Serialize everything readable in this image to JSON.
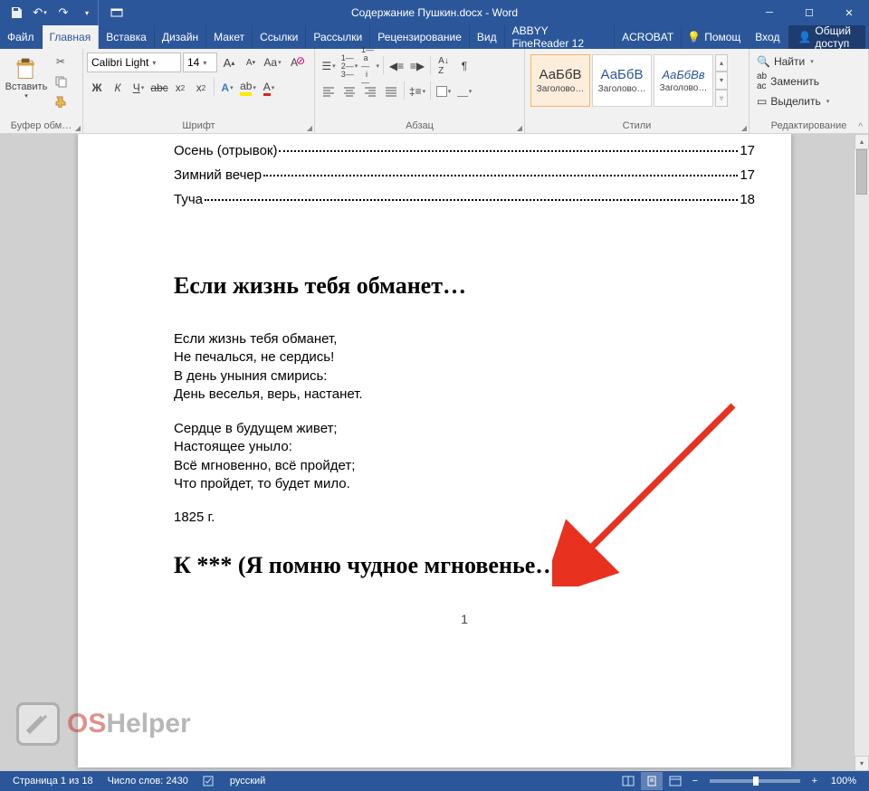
{
  "titlebar": {
    "title": "Содержание Пушкин.docx - Word"
  },
  "tabs": {
    "file": "Файл",
    "home": "Главная",
    "insert": "Вставка",
    "design": "Дизайн",
    "layout": "Макет",
    "references": "Ссылки",
    "mailings": "Рассылки",
    "review": "Рецензирование",
    "view": "Вид",
    "finereader": "ABBYY FineReader 12",
    "acrobat": "ACROBAT",
    "help": "Помощ",
    "signin": "Вход",
    "share": "Общий доступ"
  },
  "ribbon": {
    "clipboard": {
      "label": "Буфер обм…",
      "paste": "Вставить"
    },
    "font": {
      "label": "Шрифт",
      "name": "Calibri Light",
      "size": "14"
    },
    "paragraph": {
      "label": "Абзац"
    },
    "styles": {
      "label": "Стили",
      "items": [
        {
          "sample": "АаБбВ",
          "name": "Заголово…"
        },
        {
          "sample": "АаБбВ",
          "name": "Заголово…"
        },
        {
          "sample": "АаБбВв",
          "name": "Заголово…"
        }
      ]
    },
    "editing": {
      "label": "Редактирование",
      "find": "Найти",
      "replace": "Заменить",
      "select": "Выделить"
    }
  },
  "document": {
    "toc": [
      {
        "title": "Осень (отрывок)",
        "page": "17"
      },
      {
        "title": "Зимний вечер",
        "page": "17"
      },
      {
        "title": "Туча",
        "page": "18"
      }
    ],
    "heading1": "Если жизнь тебя обманет…",
    "stanza1": "Если жизнь тебя обманет,\nНе печалься, не сердись!\nВ день уныния смирись:\nДень веселья, верь, настанет.",
    "stanza2": "Сердце в будущем живет;\nНастоящее уныло:\nВсё мгновенно, всё пройдет;\nЧто пройдет, то будет мило.",
    "year": "1825 г.",
    "heading2": "К *** (Я помню чудное мгновенье…)",
    "pagenum": "1"
  },
  "status": {
    "page": "Страница 1 из 18",
    "words": "Число слов: 2430",
    "lang": "русский",
    "zoom": "100%"
  },
  "watermark": {
    "os": "OS",
    "helper": "Helper"
  }
}
